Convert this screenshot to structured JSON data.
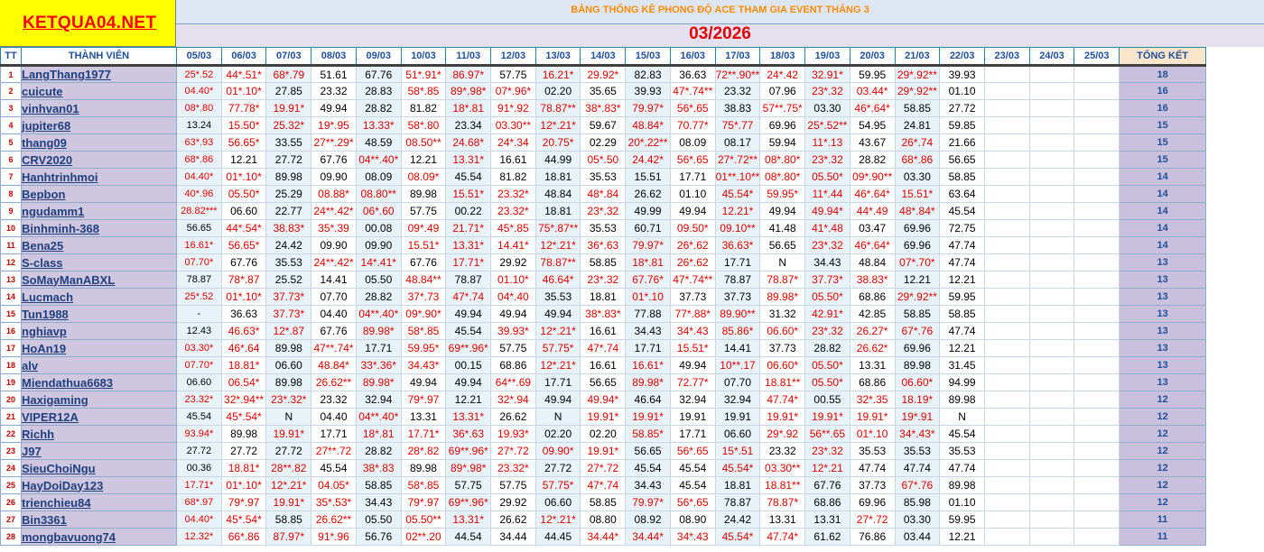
{
  "site": {
    "logo_text": "KETQUA04.NET"
  },
  "banner": {
    "title": "BẢNG THỐNG KÊ PHONG ĐỘ ACE THAM GIA EVENT THÁNG 3",
    "month": "03/2026"
  },
  "columns": {
    "tt": "TT",
    "member": "THÀNH VIÊN",
    "total": "TỔNG KẾT",
    "dates": [
      "05/03",
      "06/03",
      "07/03",
      "08/03",
      "09/03",
      "10/03",
      "11/03",
      "12/03",
      "13/03",
      "14/03",
      "15/03",
      "16/03",
      "17/03",
      "18/03",
      "19/03",
      "20/03",
      "21/03",
      "22/03",
      "23/03",
      "24/03",
      "25/03"
    ]
  },
  "colors": {
    "logo_bg": "#ffff00",
    "logo_text": "#ff0000",
    "title": "#ff8c00",
    "month": "#e00000",
    "hit_text": "#e00000",
    "name_bg": "#cfc6df",
    "total_header_bg": "#fbe6cc"
  },
  "rows": [
    {
      "tt": "1",
      "name": "LangThang1977",
      "total": "18",
      "v": [
        "25*.52",
        "44*.51*",
        "68*.79",
        "51.61",
        "67.76",
        "51*.91*",
        "86.97*",
        "57.75",
        "16.21*",
        "29.92*",
        "82.83",
        "36.63",
        "72**.90**",
        "24*.42",
        "32.91*",
        "59.95",
        "29*.92**",
        "39.93"
      ]
    },
    {
      "tt": "2",
      "name": "cuicute",
      "total": "16",
      "v": [
        "04.40*",
        "01*.10*",
        "27.85",
        "23.32",
        "28.83",
        "58*.85",
        "89*.98*",
        "07*.96*",
        "02.20",
        "35.65",
        "39.93",
        "47*.74**",
        "23.32",
        "07.96",
        "23*.32",
        "03.44*",
        "29*.92**",
        "01.10"
      ]
    },
    {
      "tt": "3",
      "name": "vinhvan01",
      "total": "16",
      "v": [
        "08*.80",
        "77.78*",
        "19.91*",
        "49.94",
        "28.82",
        "81.82",
        "18*.81",
        "91*.92",
        "78.87**",
        "38*.83*",
        "79.97*",
        "56*.65",
        "38.83",
        "57**.75*",
        "03.30",
        "46*.64*",
        "58.85",
        "27.72"
      ]
    },
    {
      "tt": "4",
      "name": "jupiter68",
      "total": "15",
      "v": [
        "13.24",
        "15.50*",
        "25.32*",
        "19*.95",
        "13.33*",
        "58*.80",
        "23.34",
        "03.30**",
        "12*.21*",
        "59.67",
        "48.84*",
        "70.77*",
        "75*.77",
        "69.96",
        "25*.52**",
        "54.95",
        "24.81",
        "59.85"
      ]
    },
    {
      "tt": "5",
      "name": "thang09",
      "total": "15",
      "v": [
        "63*.93",
        "56.65*",
        "33.55",
        "27**.29*",
        "48.59",
        "08.50**",
        "24.68*",
        "24*.34",
        "20.75*",
        "02.29",
        "20*.22**",
        "08.09",
        "08.17",
        "59.94",
        "11*.13",
        "43.67",
        "26*.74",
        "21.66"
      ]
    },
    {
      "tt": "6",
      "name": "CRV2020",
      "total": "15",
      "v": [
        "68*.86",
        "12.21",
        "27.72",
        "67.76",
        "04**.40*",
        "12.21",
        "13.31*",
        "16.61",
        "44.99",
        "05*.50",
        "24.42*",
        "56*.65",
        "27*.72**",
        "08*.80*",
        "23*.32",
        "28.82",
        "68*.86",
        "56.65"
      ]
    },
    {
      "tt": "7",
      "name": "Hanhtrinhmoi",
      "total": "14",
      "v": [
        "04.40*",
        "01*.10*",
        "89.98",
        "09.90",
        "08.09",
        "08.09*",
        "45.54",
        "81.82",
        "18.81",
        "35.53",
        "15.51",
        "17.71",
        "01**.10**",
        "08*.80*",
        "05.50*",
        "09*.90**",
        "03.30",
        "58.85"
      ]
    },
    {
      "tt": "8",
      "name": "Bepbon",
      "total": "14",
      "v": [
        "40*.96",
        "05.50*",
        "25.29",
        "08.88*",
        "08.80**",
        "89.98",
        "15.51*",
        "23.32*",
        "48.84",
        "48*.84",
        "26.62",
        "01.10",
        "45.54*",
        "59.95*",
        "11*.44",
        "46*.64*",
        "15.51*",
        "63.64"
      ]
    },
    {
      "tt": "9",
      "name": "ngudamm1",
      "total": "14",
      "v": [
        "28.82***",
        "06.60",
        "22.77",
        "24**.42*",
        "06*.60",
        "57.75",
        "00.22",
        "23.32*",
        "18.81",
        "23*.32",
        "49.99",
        "49.94",
        "12.21*",
        "49.94",
        "49.94*",
        "44*.49",
        "48*.84*",
        "45.54"
      ]
    },
    {
      "tt": "10",
      "name": "Binhminh-368",
      "total": "14",
      "v": [
        "56.65",
        "44*.54*",
        "38.83*",
        "35*.39",
        "00.08",
        "09*.49",
        "21.71*",
        "45*.85",
        "75*.87**",
        "35.53",
        "60.71",
        "09.50*",
        "09.10**",
        "41.48",
        "41*.48",
        "03.47",
        "69.96",
        "72.75"
      ]
    },
    {
      "tt": "11",
      "name": "Bena25",
      "total": "14",
      "v": [
        "16.61*",
        "56.65*",
        "24.42",
        "09.90",
        "09.90",
        "15.51*",
        "13.31*",
        "14.41*",
        "12*.21*",
        "36*.63",
        "79.97*",
        "26*.62",
        "36.63*",
        "56.65",
        "23*.32",
        "46*.64*",
        "69.96",
        "47.74"
      ]
    },
    {
      "tt": "12",
      "name": "S-class",
      "total": "13",
      "v": [
        "07.70*",
        "67.76",
        "35.53",
        "24**.42*",
        "14*.41*",
        "67.76",
        "17.71*",
        "29.92",
        "78.87**",
        "58.85",
        "18*.81",
        "26*.62",
        "17.71",
        "N",
        "34.43",
        "48.84",
        "07*.70*",
        "47.74"
      ]
    },
    {
      "tt": "13",
      "name": "SoMayManABXL",
      "total": "13",
      "v": [
        "78.87",
        "78*.87",
        "25.52",
        "14.41",
        "05.50",
        "48.84**",
        "78.87",
        "01.10*",
        "46.64*",
        "23*.32",
        "67.76*",
        "47*.74**",
        "78.87",
        "78.87*",
        "37.73*",
        "38.83*",
        "12.21",
        "12.21"
      ]
    },
    {
      "tt": "14",
      "name": "Lucmach",
      "total": "13",
      "v": [
        "25*.52",
        "01*.10*",
        "37.73*",
        "07.70",
        "28.82",
        "37*.73",
        "47*.74",
        "04*.40",
        "35.53",
        "18.81",
        "01*.10",
        "37.73",
        "37.73",
        "89.98*",
        "05.50*",
        "68.86",
        "29*.92**",
        "59.95"
      ]
    },
    {
      "tt": "15",
      "name": "Tun1988",
      "total": "13",
      "v": [
        "-",
        "36.63",
        "37.73*",
        "04.40",
        "04**.40*",
        "09*.90*",
        "49.94",
        "49.94",
        "49.94",
        "38*.83*",
        "77.88",
        "77*.88*",
        "89.90**",
        "31.32",
        "42.91*",
        "42.85",
        "58.85",
        "58.85"
      ]
    },
    {
      "tt": "16",
      "name": "nghiavp",
      "total": "13",
      "v": [
        "12.43",
        "46.63*",
        "12*.87",
        "67.76",
        "89.98*",
        "58*.85",
        "45.54",
        "39.93*",
        "12*.21*",
        "16.61",
        "34.43",
        "34*.43",
        "85.86*",
        "06.60*",
        "23*.32",
        "26.27*",
        "67*.76",
        "47.74"
      ]
    },
    {
      "tt": "17",
      "name": "HoAn19",
      "total": "13",
      "v": [
        "03.30*",
        "46*.64",
        "89.98",
        "47**.74*",
        "17.71",
        "59.95*",
        "69**.96*",
        "57.75",
        "57.75*",
        "47*.74",
        "17.71",
        "15.51*",
        "14.41",
        "37.73",
        "28.82",
        "26.62*",
        "69.96",
        "12.21"
      ]
    },
    {
      "tt": "18",
      "name": "alv",
      "total": "13",
      "v": [
        "07.70*",
        "18.81*",
        "06.60",
        "48.84*",
        "33*.36*",
        "34.43*",
        "00.15",
        "68.86",
        "12*.21*",
        "16.61",
        "16.61*",
        "49.94",
        "10**.17",
        "06.60*",
        "05.50*",
        "13.31",
        "89.98",
        "31.45"
      ]
    },
    {
      "tt": "19",
      "name": "Miendathua6683",
      "total": "13",
      "v": [
        "06.60",
        "06.54*",
        "89.98",
        "26.62**",
        "89.98*",
        "49.94",
        "49.94",
        "64**.69",
        "17.71",
        "56.65",
        "89.98*",
        "72.77*",
        "07.70",
        "18.81**",
        "05.50*",
        "68.86",
        "06.60*",
        "94.99"
      ]
    },
    {
      "tt": "20",
      "name": "Haxigaming",
      "total": "12",
      "v": [
        "23.32*",
        "32*.94**",
        "23*.32*",
        "23.32",
        "32.94",
        "79*.97",
        "12.21",
        "32*.94",
        "49.94",
        "49.94*",
        "46.64",
        "32.94",
        "32.94",
        "47.74*",
        "00.55",
        "32*.35",
        "18.19*",
        "89.98"
      ]
    },
    {
      "tt": "21",
      "name": "VIPER12A",
      "total": "12",
      "v": [
        "45.54",
        "45*.54*",
        "N",
        "04.40",
        "04**.40*",
        "13.31",
        "13.31*",
        "26.62",
        "N",
        "19.91*",
        "19.91*",
        "19.91",
        "19.91",
        "19.91*",
        "19.91*",
        "19.91*",
        "19*.91",
        "N"
      ]
    },
    {
      "tt": "22",
      "name": "Richh",
      "total": "12",
      "v": [
        "93.94*",
        "89.98",
        "19.91*",
        "17.71",
        "18*.81",
        "17.71*",
        "36*.63",
        "19.93*",
        "02.20",
        "02.20",
        "58.85*",
        "17.71",
        "06.60",
        "29*.92",
        "56**.65",
        "01*.10",
        "34*.43*",
        "45.54"
      ]
    },
    {
      "tt": "23",
      "name": "J97",
      "total": "12",
      "v": [
        "27.72",
        "27.72",
        "27.72",
        "27**.72",
        "28.82",
        "28*.82",
        "69**.96*",
        "27*.72",
        "09.90*",
        "19.91*",
        "56.65",
        "56*.65",
        "15*.51",
        "23.32",
        "23*.32",
        "35.53",
        "35.53",
        "35.53"
      ]
    },
    {
      "tt": "24",
      "name": "SieuChoiNgu",
      "total": "12",
      "v": [
        "00.36",
        "18.81*",
        "28**.82",
        "45.54",
        "38*.83",
        "89.98",
        "89*.98*",
        "23.32*",
        "27.72",
        "27*.72",
        "45.54",
        "45.54",
        "45.54*",
        "03.30**",
        "12*.21",
        "47.74",
        "47.74",
        "47.74"
      ]
    },
    {
      "tt": "25",
      "name": "HayDoiDay123",
      "total": "12",
      "v": [
        "17.71*",
        "01*.10*",
        "12*.21*",
        "04.05*",
        "58.85",
        "58*.85",
        "57.75",
        "57.75",
        "57.75*",
        "47*.74",
        "34.43",
        "45.54",
        "18.81",
        "18.81**",
        "67.76",
        "37.73",
        "67*.76",
        "89.98"
      ]
    },
    {
      "tt": "26",
      "name": "trienchieu84",
      "total": "12",
      "v": [
        "68*.97",
        "79*.97",
        "19.91*",
        "35*.53*",
        "34.43",
        "79*.97",
        "69**.96*",
        "29.92",
        "06.60",
        "58.85",
        "79.97*",
        "56*.65",
        "78.87",
        "78.87*",
        "68.86",
        "69.96",
        "85.98",
        "01.10"
      ]
    },
    {
      "tt": "27",
      "name": "Bin3361",
      "total": "11",
      "v": [
        "04.40*",
        "45*.54*",
        "58.85",
        "26.62**",
        "05.50",
        "05.50**",
        "13.31*",
        "26.62",
        "12*.21*",
        "08.80",
        "08.92",
        "08.90",
        "24.42",
        "13.31",
        "13.31",
        "27*.72",
        "03.30",
        "59.95"
      ]
    },
    {
      "tt": "28",
      "name": "mongbavuong74",
      "total": "11",
      "v": [
        "12.32*",
        "66*.86",
        "87.97*",
        "91*.96",
        "56.76",
        "02**.20",
        "44.54",
        "34.44",
        "44.45",
        "34.44*",
        "34.44*",
        "34*.43",
        "45.54*",
        "47.74*",
        "61.62",
        "76.86",
        "03.44",
        "12.21"
      ]
    }
  ]
}
